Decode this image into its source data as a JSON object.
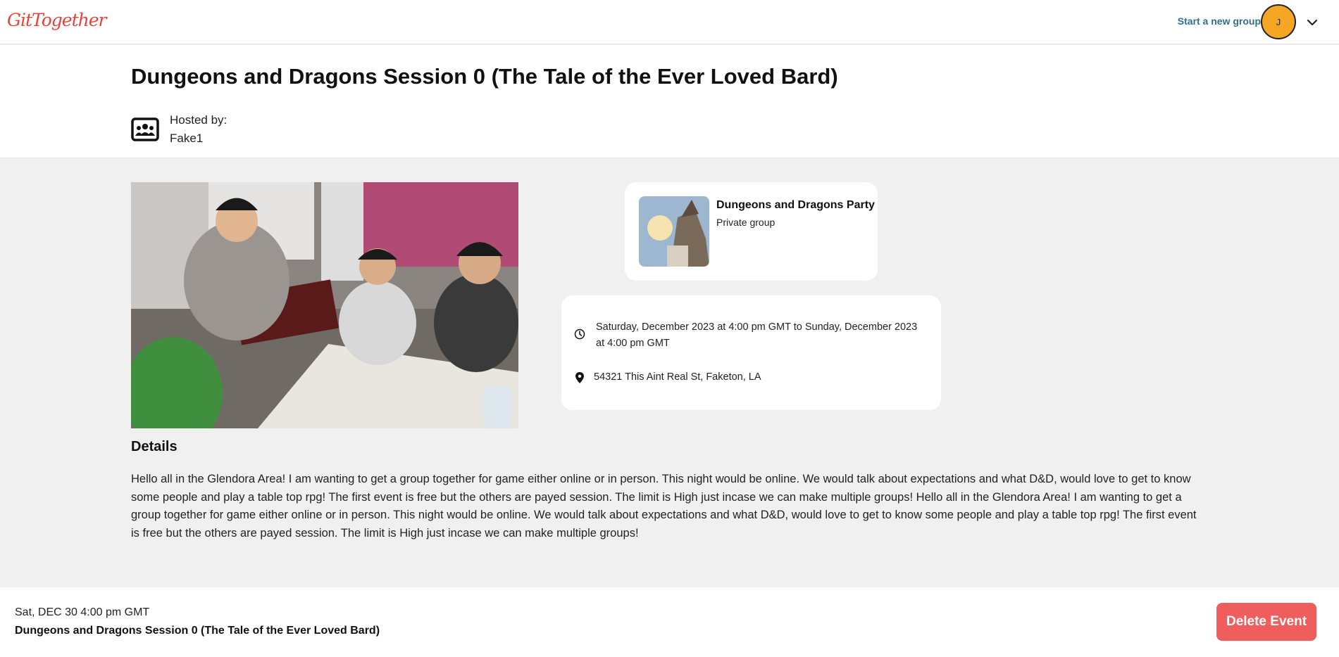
{
  "nav": {
    "logo_text": "GitTogether",
    "start_group_label": "Start a new group",
    "avatar_initial": "J",
    "avatar_color": "#f5a623",
    "menu_icon": "chevron-down-icon"
  },
  "event": {
    "title": "Dungeons and Dragons Session 0 (The Tale of the Ever Loved Bard)",
    "hosted_by_label": "Hosted by:",
    "host_name": "Fake1",
    "host_icon": "group-icon",
    "photo_icon": "event-photo"
  },
  "group_card": {
    "name": "Dungeons and Dragons Party",
    "type": "Private group"
  },
  "info": {
    "datetime": "Saturday, December 2023 at 4:00 pm GMT to Sunday, December 2023 at 4:00 pm GMT",
    "address": "54321 This Aint Real St, Faketon, LA",
    "clock_icon": "clock-icon",
    "pin_icon": "map-pin-icon"
  },
  "details": {
    "heading": "Details",
    "text": "Hello all in the Glendora Area! I am wanting to get a group together for game either online or in person. This night would be online. We would talk about expectations and what D&D, would love to get to know some people and play a table top rpg! The first event is free but the others are payed session. The limit is High just incase we can make multiple groups! Hello all in the Glendora Area! I am wanting to get a group together for game either online or in person. This night would be online. We would talk about expectations and what D&D, would love to get to know some people and play a table top rpg! The first event is free but the others are payed session. The limit is High just incase we can make multiple groups!"
  },
  "footer": {
    "date": "Sat, DEC 30 4:00 pm GMT",
    "title": "Dungeons and Dragons Session 0 (The Tale of the Ever Loved Bard)",
    "delete_label": "Delete Event",
    "delete_color": "#ef5d5d"
  }
}
